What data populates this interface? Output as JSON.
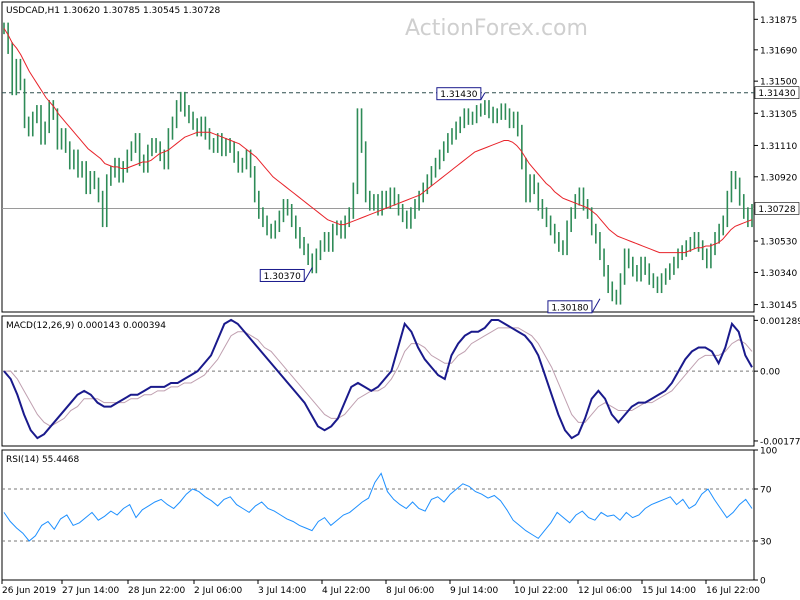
{
  "watermark": "ActionForex.com",
  "chart_data": {
    "type": "line",
    "symbol_header": "USDCAD,H1  1.30620 1.30785 1.30545 1.30728",
    "x_tick_labels": [
      "26 Jun 2019",
      "27 Jun 14:00",
      "28 Jun 22:00",
      "2 Jul 06:00",
      "3 Jul 14:00",
      "4 Jul 22:00",
      "8 Jul 06:00",
      "9 Jul 14:00",
      "10 Jul 22:00",
      "12 Jul 06:00",
      "15 Jul 14:00",
      "16 Jul 22:00"
    ],
    "panels": [
      {
        "id": "price",
        "y_tick_labels": [
          "1.31875",
          "1.31690",
          "1.31500",
          "1.31305",
          "1.31110",
          "1.30920",
          "1.30530",
          "1.30340",
          "1.30145"
        ],
        "ylim": [
          1.301,
          1.3198
        ],
        "horizontal_levels": [
          {
            "value": 1.3143,
            "label": "1.31430",
            "style": "dashed"
          },
          {
            "value": 1.30728,
            "label": "1.30728",
            "style": "solid"
          }
        ],
        "annotations": [
          {
            "label": "1.30370",
            "x_index": 75,
            "value": 1.3037
          },
          {
            "label": "1.31430",
            "x_index": 117,
            "value": 1.3143
          },
          {
            "label": "1.30180",
            "x_index": 145,
            "value": 1.3018
          }
        ],
        "series": [
          {
            "type": "bars",
            "color": "#2e8b57",
            "values": [
              1.3182,
              1.317,
              1.3145,
              1.316,
              1.3148,
              1.3125,
              1.312,
              1.3128,
              1.3132,
              1.3115,
              1.3122,
              1.3135,
              1.313,
              1.3112,
              1.3118,
              1.311,
              1.31,
              1.3105,
              1.3095,
              1.3098,
              1.3085,
              1.3092,
              1.3088,
              1.308,
              1.3065,
              1.309,
              1.3095,
              1.31,
              1.3092,
              1.3098,
              1.3105,
              1.311,
              1.3115,
              1.3102,
              1.3098,
              1.3108,
              1.3112,
              1.311,
              1.3105,
              1.31,
              1.3118,
              1.3125,
              1.3135,
              1.314,
              1.3132,
              1.3128,
              1.3124,
              1.312,
              1.3125,
              1.3118,
              1.3112,
              1.311,
              1.3115,
              1.3108,
              1.3112,
              1.311,
              1.3104,
              1.3098,
              1.31,
              1.3105,
              1.3095,
              1.308,
              1.307,
              1.3065,
              1.306,
              1.3058,
              1.3062,
              1.3068,
              1.3075,
              1.3072,
              1.3065,
              1.3058,
              1.3052,
              1.3048,
              1.3042,
              1.3037,
              1.3045,
              1.305,
              1.3055,
              1.305,
              1.306,
              1.3062,
              1.3058,
              1.3065,
              1.307,
              1.3085,
              1.313,
              1.311,
              1.308,
              1.3075,
              1.3078,
              1.3072,
              1.308,
              1.3076,
              1.3082,
              1.3078,
              1.3072,
              1.3068,
              1.3064,
              1.307,
              1.3075,
              1.308,
              1.3085,
              1.309,
              1.3095,
              1.31,
              1.3105,
              1.311,
              1.3115,
              1.3118,
              1.3122,
              1.3125,
              1.313,
              1.3127,
              1.3128,
              1.3132,
              1.3133,
              1.3135,
              1.3131,
              1.3128,
              1.313,
              1.3133,
              1.313,
              1.3125,
              1.3128,
              1.312,
              1.31,
              1.308,
              1.309,
              1.3085,
              1.3075,
              1.307,
              1.3065,
              1.306,
              1.3055,
              1.305,
              1.3048,
              1.3062,
              1.307,
              1.3078,
              1.3082,
              1.3075,
              1.307,
              1.306,
              1.3055,
              1.3045,
              1.3035,
              1.3025,
              1.302,
              1.3018,
              1.303,
              1.3045,
              1.304,
              1.3035,
              1.3032,
              1.304,
              1.3036,
              1.303,
              1.3028,
              1.3025,
              1.303,
              1.3033,
              1.3036,
              1.304,
              1.3045,
              1.3047,
              1.305,
              1.3052,
              1.3055,
              1.305,
              1.3045,
              1.304,
              1.3048,
              1.3055,
              1.306,
              1.3065,
              1.308,
              1.3092,
              1.3088,
              1.3078,
              1.307,
              1.3065,
              1.3072
            ]
          },
          {
            "type": "line",
            "name": "",
            "color": "#e8232a",
            "values": [
              1.3182,
              1.3178,
              1.3173,
              1.317,
              1.3166,
              1.3161,
              1.3156,
              1.3152,
              1.3148,
              1.3144,
              1.314,
              1.3137,
              1.3134,
              1.313,
              1.3127,
              1.3124,
              1.3121,
              1.3118,
              1.3115,
              1.3112,
              1.3109,
              1.3107,
              1.3105,
              1.3103,
              1.31,
              1.3099,
              1.3098,
              1.3098,
              1.3097,
              1.3097,
              1.3098,
              1.3099,
              1.31,
              1.3101,
              1.3101,
              1.3102,
              1.3104,
              1.3106,
              1.3107,
              1.3108,
              1.311,
              1.3112,
              1.3114,
              1.3116,
              1.3117,
              1.3118,
              1.3119,
              1.3119,
              1.3119,
              1.3119,
              1.3118,
              1.3117,
              1.3116,
              1.3115,
              1.3114,
              1.3113,
              1.3112,
              1.311,
              1.3108,
              1.3106,
              1.3104,
              1.3101,
              1.3098,
              1.3095,
              1.3092,
              1.309,
              1.3088,
              1.3086,
              1.3084,
              1.3082,
              1.308,
              1.3078,
              1.3076,
              1.3074,
              1.3072,
              1.307,
              1.3068,
              1.3066,
              1.3065,
              1.3064,
              1.3063,
              1.3063,
              1.3064,
              1.3065,
              1.3066,
              1.3067,
              1.3068,
              1.3069,
              1.307,
              1.3071,
              1.3072,
              1.3073,
              1.3074,
              1.3075,
              1.3076,
              1.3077,
              1.3078,
              1.3079,
              1.308,
              1.3081,
              1.3083,
              1.3085,
              1.3087,
              1.3089,
              1.3091,
              1.3093,
              1.3095,
              1.3097,
              1.3099,
              1.3101,
              1.3103,
              1.3105,
              1.3107,
              1.3108,
              1.3109,
              1.311,
              1.3111,
              1.3112,
              1.3113,
              1.3114,
              1.3114,
              1.3113,
              1.3111,
              1.3108,
              1.3104,
              1.31,
              1.3097,
              1.3094,
              1.3091,
              1.3088,
              1.3086,
              1.3083,
              1.3081,
              1.3079,
              1.3078,
              1.3077,
              1.3076,
              1.3075,
              1.3074,
              1.3073,
              1.3071,
              1.3069,
              1.3066,
              1.3063,
              1.306,
              1.3058,
              1.3056,
              1.3055,
              1.3054,
              1.3053,
              1.3052,
              1.3051,
              1.305,
              1.3049,
              1.3048,
              1.3047,
              1.3046,
              1.3046,
              1.3046,
              1.3046,
              1.3046,
              1.3046,
              1.3046,
              1.3047,
              1.3048,
              1.3049,
              1.3049,
              1.305,
              1.305,
              1.3051,
              1.3052,
              1.3054,
              1.3057,
              1.306,
              1.3062,
              1.3063,
              1.3064,
              1.3065,
              1.3066
            ]
          }
        ]
      },
      {
        "id": "macd",
        "header": "MACD(12,26,9) 0.000143 0.000394",
        "y_tick_labels": [
          "0.001289",
          "0.00",
          "-0.001772"
        ],
        "ylim": [
          -0.0019,
          0.0014
        ],
        "series": [
          {
            "type": "line",
            "name": "",
            "color": "#1a1a8c",
            "values": [
              0.0,
              -0.0002,
              -0.0006,
              -0.0011,
              -0.0015,
              -0.0017,
              -0.0016,
              -0.0014,
              -0.0012,
              -0.001,
              -0.0008,
              -0.0006,
              -0.0005,
              -0.0006,
              -0.0008,
              -0.0009,
              -0.0009,
              -0.0008,
              -0.0007,
              -0.0006,
              -0.0006,
              -0.0005,
              -0.0004,
              -0.0004,
              -0.0004,
              -0.0003,
              -0.0003,
              -0.0002,
              -0.0001,
              0.0,
              0.0002,
              0.0004,
              0.0008,
              0.0012,
              0.0013,
              0.0012,
              0.001,
              0.0008,
              0.0006,
              0.0004,
              0.0002,
              0.0,
              -0.0002,
              -0.0004,
              -0.0006,
              -0.0008,
              -0.0011,
              -0.0014,
              -0.0015,
              -0.0014,
              -0.0012,
              -0.0008,
              -0.0004,
              -0.0003,
              -0.0004,
              -0.0005,
              -0.0004,
              -0.0002,
              0.0,
              0.0006,
              0.0012,
              0.001,
              0.0006,
              0.0003,
              0.0001,
              -0.0001,
              -0.0002,
              0.0004,
              0.0007,
              0.0009,
              0.001,
              0.001,
              0.0011,
              0.0013,
              0.0013,
              0.0012,
              0.0011,
              0.001,
              0.0009,
              0.0007,
              0.0004,
              -0.0001,
              -0.0006,
              -0.0011,
              -0.0015,
              -0.0017,
              -0.0016,
              -0.0012,
              -0.0007,
              -0.0005,
              -0.0007,
              -0.0011,
              -0.0013,
              -0.0011,
              -0.0009,
              -0.0008,
              -0.0008,
              -0.0007,
              -0.0006,
              -0.0005,
              -0.0003,
              0.0,
              0.0003,
              0.0005,
              0.0006,
              0.0006,
              0.0005,
              0.0002,
              0.0006,
              0.0012,
              0.001,
              0.0004,
              0.0001
            ]
          },
          {
            "type": "line",
            "name": "",
            "color": "#c0a0b0",
            "values": [
              0.0,
              0.0,
              -0.0002,
              -0.0005,
              -0.0008,
              -0.0011,
              -0.0013,
              -0.0014,
              -0.0013,
              -0.0012,
              -0.001,
              -0.0009,
              -0.0007,
              -0.0007,
              -0.0007,
              -0.0008,
              -0.0008,
              -0.0008,
              -0.0008,
              -0.0007,
              -0.0007,
              -0.0006,
              -0.0006,
              -0.0005,
              -0.0005,
              -0.0004,
              -0.0004,
              -0.0003,
              -0.0003,
              -0.0002,
              -0.0001,
              0.0001,
              0.0003,
              0.0006,
              0.0009,
              0.001,
              0.001,
              0.0009,
              0.0008,
              0.0006,
              0.0005,
              0.0003,
              0.0001,
              -0.0001,
              -0.0003,
              -0.0005,
              -0.0007,
              -0.0009,
              -0.0011,
              -0.0012,
              -0.0012,
              -0.0011,
              -0.0009,
              -0.0007,
              -0.0006,
              -0.0005,
              -0.0005,
              -0.0004,
              -0.0002,
              0.0001,
              0.0005,
              0.0007,
              0.0007,
              0.0006,
              0.0004,
              0.0003,
              0.0002,
              0.0002,
              0.0004,
              0.0005,
              0.0007,
              0.0008,
              0.0009,
              0.001,
              0.0011,
              0.0011,
              0.0011,
              0.0011,
              0.001,
              0.0009,
              0.0007,
              0.0004,
              0.0001,
              -0.0003,
              -0.0007,
              -0.0011,
              -0.0013,
              -0.0013,
              -0.0011,
              -0.0009,
              -0.0008,
              -0.0009,
              -0.001,
              -0.001,
              -0.001,
              -0.0009,
              -0.0008,
              -0.0008,
              -0.0007,
              -0.0006,
              -0.0005,
              -0.0003,
              -0.0001,
              0.0001,
              0.0003,
              0.0004,
              0.0004,
              0.0004,
              0.0005,
              0.0007,
              0.0008,
              0.0007,
              0.0005
            ]
          }
        ]
      },
      {
        "id": "rsi",
        "header": "RSI(14) 55.4468",
        "y_tick_labels": [
          "100",
          "70",
          "30",
          "0"
        ],
        "ylim": [
          0,
          100
        ],
        "horizontal_levels": [
          {
            "value": 70,
            "style": "dashed"
          },
          {
            "value": 30,
            "style": "dashed"
          }
        ],
        "series": [
          {
            "type": "line",
            "name": "",
            "color": "#1e90ff",
            "values": [
              52,
              45,
              40,
              36,
              30,
              34,
              42,
              45,
              39,
              47,
              50,
              42,
              44,
              48,
              52,
              46,
              49,
              53,
              50,
              55,
              58,
              48,
              54,
              57,
              60,
              62,
              58,
              55,
              60,
              66,
              70,
              68,
              64,
              61,
              57,
              62,
              64,
              58,
              55,
              52,
              57,
              60,
              55,
              53,
              50,
              47,
              45,
              42,
              40,
              38,
              45,
              48,
              42,
              46,
              50,
              52,
              56,
              60,
              63,
              75,
              82,
              68,
              62,
              58,
              55,
              60,
              55,
              53,
              62,
              64,
              60,
              66,
              70,
              74,
              72,
              68,
              66,
              63,
              65,
              61,
              54,
              46,
              42,
              38,
              35,
              32,
              38,
              44,
              52,
              48,
              44,
              50,
              53,
              48,
              46,
              52,
              49,
              50,
              46,
              52,
              48,
              50,
              55,
              58,
              60,
              62,
              64,
              58,
              62,
              55,
              58,
              66,
              70,
              62,
              55,
              48,
              52,
              58,
              62,
              55
            ]
          }
        ]
      }
    ]
  }
}
